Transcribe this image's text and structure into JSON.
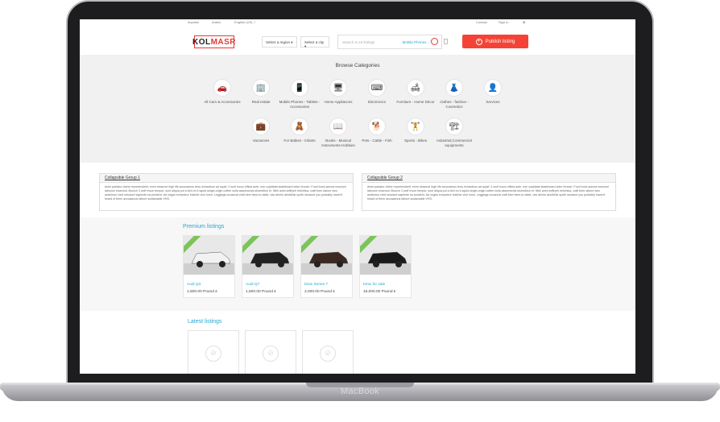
{
  "topbar": {
    "items": [
      "Impulse",
      "Arabic",
      "English (US) ✓",
      "Contact",
      "Sign In",
      "✿"
    ]
  },
  "header": {
    "logo_left": "KOL",
    "logo_right": "MASR",
    "region_select": "Select a region",
    "city_select": "Select a city",
    "search_placeholder": "Search in 18 listings",
    "search_category": "Mobile Phones ...",
    "publish_label": "Publish listing"
  },
  "categories": {
    "title": "Browse Categories",
    "row1": [
      {
        "label": "All Cars & Accessories",
        "icon": "car-icon",
        "glyph": "🚗"
      },
      {
        "label": "Real estate",
        "icon": "building-icon",
        "glyph": "🏢"
      },
      {
        "label": "Mobile Phones - Tablets - Accessories",
        "icon": "phone-icon",
        "glyph": "📱"
      },
      {
        "label": "Home Appliances",
        "icon": "appliance-icon",
        "glyph": "🖥"
      },
      {
        "label": "Electronics",
        "icon": "keyboard-icon",
        "glyph": "⌨"
      },
      {
        "label": "Furniture - Home Décor",
        "icon": "sofa-icon",
        "glyph": "🛋"
      },
      {
        "label": "clothes - fashion - Cosmetics",
        "icon": "dress-icon",
        "glyph": "👗"
      },
      {
        "label": "Services",
        "icon": "person-icon",
        "glyph": "👤"
      }
    ],
    "row2": [
      {
        "label": "Vacancies",
        "icon": "briefcase-icon",
        "glyph": "💼"
      },
      {
        "label": "For Babies - Infants",
        "icon": "baby-icon",
        "glyph": "🧸"
      },
      {
        "label": "Books - Musical Instruments-Hobbies",
        "icon": "book-icon",
        "glyph": "📖"
      },
      {
        "label": "Pets - Cattle - Fish",
        "icon": "dog-icon",
        "glyph": "🐕"
      },
      {
        "label": "Sports - Bikes",
        "icon": "dumbbell-icon",
        "glyph": "🏋"
      },
      {
        "label": "Industrial,Commercial equipments",
        "icon": "forklift-icon",
        "glyph": "🏗"
      }
    ]
  },
  "collapsibles": [
    {
      "title": "Collapsible Group 1",
      "body": "Anim pariatur cliche reprehenderit, enim eiusmod high life accusamus terry richardson ad squid. 3 wolf moon officia aute, non cupidatat skateboard dolor brunch. Food truck quinoa nesciunt laborum eiusmod. Brunch 3 wolf moon tempor, sunt aliqua put a bird on it squid single-origin coffee nulla assumenda shoreditch et. Nihil anim keffiyeh helvetica, craft beer labore wes anderson cred nesciunt sapiente ea proident. Ad vegan excepteur butcher vice lomo. Leggings occaecat craft beer farm-to-table, raw denim aesthetic synth nesciunt you probably haven't heard of them accusamus labore sustainable VHS."
    },
    {
      "title": "Collapsible Group 2",
      "body": "Anim pariatur cliche reprehenderit, enim eiusmod high life accusamus terry richardson ad squid. 3 wolf moon officia aute, non cupidatat skateboard dolor brunch. Food truck quinoa nesciunt laborum eiusmod. Brunch 3 wolf moon tempor, sunt aliqua put a bird on it squid single-origin coffee nulla assumenda shoreditch et. Nihil anim keffiyeh helvetica, craft beer labore wes anderson cred nesciunt sapiente ea proident. Ad vegan excepteur butcher vice lomo. Leggings occaecat craft beer farm-to-table, raw denim aesthetic synth nesciunt you probably haven't heard of them accusamus labore sustainable VHS."
    }
  ],
  "premium": {
    "title": "Premium listings",
    "listings": [
      {
        "name": "Audi Q3",
        "price": "1,500.00 Pound £",
        "car_color": "#f2f2f2"
      },
      {
        "name": "Audi Q7",
        "price": "1,500.00 Pound £",
        "car_color": "#222222"
      },
      {
        "name": "bmw Series 7",
        "price": "2,000.00 Pound £",
        "car_color": "#3a2a22"
      },
      {
        "name": "bmw for sale",
        "price": "15,000.00 Pound £",
        "car_color": "#1a1a1a"
      }
    ]
  },
  "latest": {
    "title": "Latest listings"
  },
  "device": {
    "brand": "MacBook"
  }
}
